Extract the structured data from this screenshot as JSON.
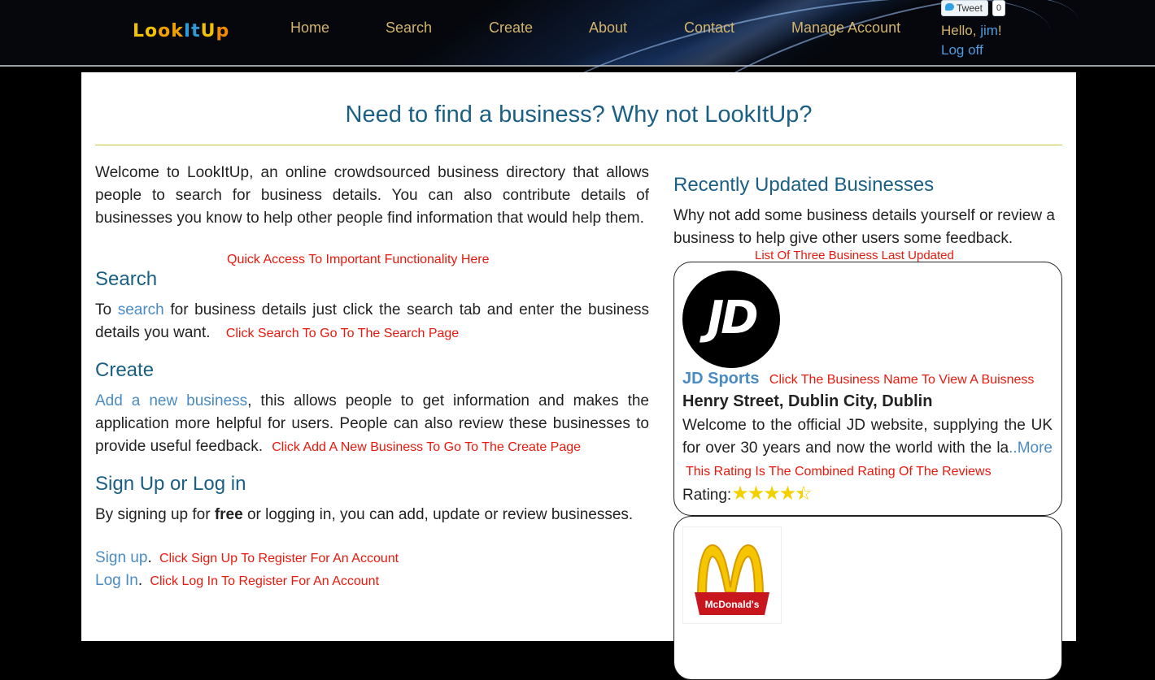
{
  "header": {
    "logo_text": "LookItUp",
    "nav": [
      "Home",
      "Search",
      "Create",
      "About",
      "Contact",
      "Manage Account"
    ],
    "tweet_label": "Tweet",
    "tweet_count": "0",
    "hello_prefix": "Hello,",
    "username": "jim",
    "hello_suffix": "!",
    "logoff": "Log off"
  },
  "main": {
    "title": "Need to find a business? Why not LookItUp?",
    "welcome": "Welcome to LookItUp, an online crowdsourced business directory that allows people to search for business details. You can also contribute details of businesses you know to help other people find information that would help them.",
    "note_quick_access": "Quick Access To Important Functionality Here",
    "search": {
      "heading": "Search",
      "prefix": "To",
      "link": "search",
      "text": "for business details just click the search tab and enter the business details you want.",
      "note": "Click Search To Go To The Search Page"
    },
    "create": {
      "heading": "Create",
      "link": "Add a new business",
      "text": ", this allows people to get information and makes the application more helpful for users. People can also review these businesses to provide useful feedback.",
      "note": "Click Add A New Business To Go To The Create Page"
    },
    "signup": {
      "heading": "Sign Up or Log in",
      "text_before": "By signing up for",
      "text_bold": "free",
      "text_after": "or logging in, you can add, update or review businesses.",
      "signup_link": "Sign up",
      "signup_note": "Click Sign Up To Register For An Account",
      "login_link": "Log In",
      "login_note": "Click Log In To Register For An Account"
    }
  },
  "sidebar": {
    "heading": "Recently Updated Businesses",
    "intro": "Why not add some business details yourself or review a business to help give other users some feedback.",
    "note_list": "List Of Three Business Last Updated",
    "businesses": [
      {
        "logo_text": "JD",
        "name": "JD Sports",
        "name_note": "Click The Business Name To View A Buisness",
        "address": "Henry Street, Dublin City, Dublin",
        "description": "Welcome to the official JD website, supplying the UK for over 30 years and now the world with the la",
        "more_link": "..More",
        "rating_note": "This Rating Is The Combined Rating Of The Reviews",
        "rating_label": "Rating:",
        "rating": 4.5
      },
      {
        "logo_text": "McDonald's"
      }
    ]
  }
}
